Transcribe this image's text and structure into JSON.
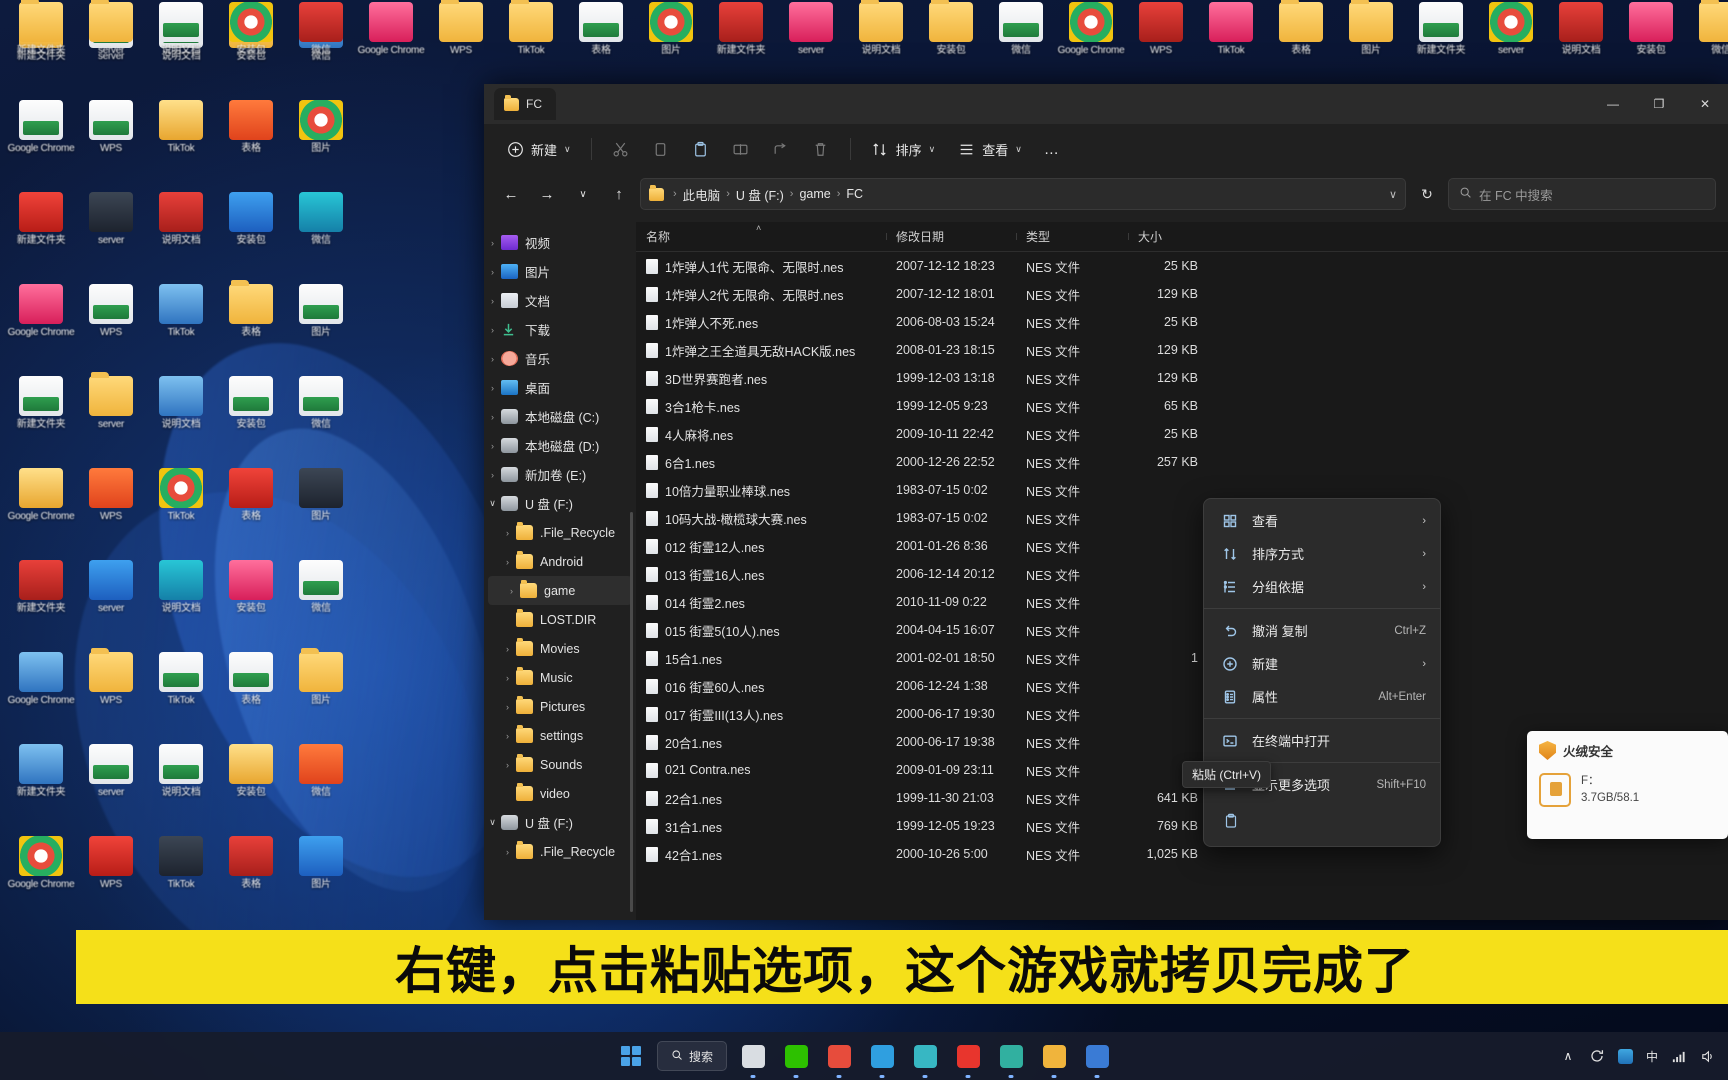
{
  "window": {
    "tab_title": "FC",
    "minimize": "—",
    "maximize": "❐",
    "close": "✕"
  },
  "toolbar": {
    "new_label": "新建",
    "new_caret": "∨",
    "cut_label": "剪切",
    "copy_label": "复制",
    "paste_label": "粘贴",
    "rename_label": "重命名",
    "share_label": "共享",
    "delete_label": "删除",
    "sort_label": "排序",
    "sort_caret": "∨",
    "view_label": "查看",
    "view_caret": "∨",
    "more_label": "…"
  },
  "address": {
    "back": "←",
    "forward": "→",
    "recent": "∨",
    "up": "↑",
    "crumbs": [
      "此电脑",
      "U 盘 (F:)",
      "game",
      "FC"
    ],
    "separator": "›",
    "dropdown": "∨",
    "refresh": "↻",
    "search_placeholder": "在 FC 中搜索"
  },
  "navpane": {
    "items": [
      {
        "label": "视频",
        "icon": "video-icon",
        "indent": 0,
        "chevron": "closed"
      },
      {
        "label": "图片",
        "icon": "pictures-icon",
        "indent": 0,
        "chevron": "closed"
      },
      {
        "label": "文档",
        "icon": "documents-icon",
        "indent": 0,
        "chevron": "closed"
      },
      {
        "label": "下载",
        "icon": "downloads-icon",
        "indent": 0,
        "chevron": "closed"
      },
      {
        "label": "音乐",
        "icon": "music-icon",
        "indent": 0,
        "chevron": "closed"
      },
      {
        "label": "桌面",
        "icon": "desktop-icon",
        "indent": 0,
        "chevron": "closed"
      },
      {
        "label": "本地磁盘 (C:)",
        "icon": "disk-icon",
        "indent": 0,
        "chevron": "closed"
      },
      {
        "label": "本地磁盘 (D:)",
        "icon": "disk-icon",
        "indent": 0,
        "chevron": "closed"
      },
      {
        "label": "新加卷 (E:)",
        "icon": "disk-icon",
        "indent": 0,
        "chevron": "closed"
      },
      {
        "label": "U 盘 (F:)",
        "icon": "disk-icon",
        "indent": 0,
        "chevron": "open"
      },
      {
        "label": ".File_Recycle",
        "icon": "folder-icon",
        "indent": 1,
        "chevron": "closed"
      },
      {
        "label": "Android",
        "icon": "folder-icon",
        "indent": 1,
        "chevron": "closed"
      },
      {
        "label": "game",
        "icon": "folder-icon",
        "indent": 1,
        "chevron": "closed",
        "selected": true
      },
      {
        "label": "LOST.DIR",
        "icon": "folder-icon",
        "indent": 1,
        "chevron": "none"
      },
      {
        "label": "Movies",
        "icon": "folder-icon",
        "indent": 1,
        "chevron": "closed"
      },
      {
        "label": "Music",
        "icon": "folder-icon",
        "indent": 1,
        "chevron": "closed"
      },
      {
        "label": "Pictures",
        "icon": "folder-icon",
        "indent": 1,
        "chevron": "closed"
      },
      {
        "label": "settings",
        "icon": "folder-icon",
        "indent": 1,
        "chevron": "closed"
      },
      {
        "label": "Sounds",
        "icon": "folder-icon",
        "indent": 1,
        "chevron": "closed"
      },
      {
        "label": "video",
        "icon": "folder-icon",
        "indent": 1,
        "chevron": "none"
      },
      {
        "label": "U 盘 (F:)",
        "icon": "disk-icon",
        "indent": 0,
        "chevron": "open"
      },
      {
        "label": ".File_Recycle",
        "icon": "folder-icon",
        "indent": 1,
        "chevron": "closed"
      }
    ]
  },
  "filelist": {
    "columns": [
      "名称",
      "修改日期",
      "类型",
      "大小"
    ],
    "sort_indicator": "˄",
    "rows": [
      {
        "name": "1炸弹人1代 无限命、无限时.nes",
        "date": "2007-12-12 18:23",
        "type": "NES 文件",
        "size": "25 KB"
      },
      {
        "name": "1炸弹人2代 无限命、无限时.nes",
        "date": "2007-12-12 18:01",
        "type": "NES 文件",
        "size": "129 KB"
      },
      {
        "name": "1炸弹人不死.nes",
        "date": "2006-08-03 15:24",
        "type": "NES 文件",
        "size": "25 KB"
      },
      {
        "name": "1炸弹之王全道具无敌HACK版.nes",
        "date": "2008-01-23 18:15",
        "type": "NES 文件",
        "size": "129 KB"
      },
      {
        "name": "3D世界赛跑者.nes",
        "date": "1999-12-03 13:18",
        "type": "NES 文件",
        "size": "129 KB"
      },
      {
        "name": "3合1枪卡.nes",
        "date": "1999-12-05 9:23",
        "type": "NES 文件",
        "size": "65 KB"
      },
      {
        "name": "4人麻将.nes",
        "date": "2009-10-11 22:42",
        "type": "NES 文件",
        "size": "25 KB"
      },
      {
        "name": "6合1.nes",
        "date": "2000-12-26 22:52",
        "type": "NES 文件",
        "size": "257 KB"
      },
      {
        "name": "10倍力量职业棒球.nes",
        "date": "1983-07-15 0:02",
        "type": "NES 文件",
        "size": ""
      },
      {
        "name": "10码大战-橄榄球大赛.nes",
        "date": "1983-07-15 0:02",
        "type": "NES 文件",
        "size": ""
      },
      {
        "name": "012 街霊12人.nes",
        "date": "2001-01-26 8:36",
        "type": "NES 文件",
        "size": ""
      },
      {
        "name": "013 街霊16人.nes",
        "date": "2006-12-14 20:12",
        "type": "NES 文件",
        "size": ""
      },
      {
        "name": "014 街霊2.nes",
        "date": "2010-11-09 0:22",
        "type": "NES 文件",
        "size": ""
      },
      {
        "name": "015 街霊5(10人).nes",
        "date": "2004-04-15 16:07",
        "type": "NES 文件",
        "size": ""
      },
      {
        "name": "15合1.nes",
        "date": "2001-02-01 18:50",
        "type": "NES 文件",
        "size": "1"
      },
      {
        "name": "016 街霊60人.nes",
        "date": "2006-12-24 1:38",
        "type": "NES 文件",
        "size": ""
      },
      {
        "name": "017 街霊III(13人).nes",
        "date": "2000-06-17 19:30",
        "type": "NES 文件",
        "size": ""
      },
      {
        "name": "20合1.nes",
        "date": "2000-06-17 19:38",
        "type": "NES 文件",
        "size": ""
      },
      {
        "name": "021 Contra.nes",
        "date": "2009-01-09 23:11",
        "type": "NES 文件",
        "size": ""
      },
      {
        "name": "22合1.nes",
        "date": "1999-11-30 21:03",
        "type": "NES 文件",
        "size": "641 KB"
      },
      {
        "name": "31合1.nes",
        "date": "1999-12-05 19:23",
        "type": "NES 文件",
        "size": "769 KB"
      },
      {
        "name": "42合1.nes",
        "date": "2000-10-26 5:00",
        "type": "NES 文件",
        "size": "1,025 KB"
      }
    ]
  },
  "contextmenu": {
    "items": [
      {
        "label": "查看",
        "icon": "grid-view-icon",
        "accel": "",
        "arrow": "›"
      },
      {
        "label": "排序方式",
        "icon": "sort-icon",
        "accel": "",
        "arrow": "›"
      },
      {
        "label": "分组依据",
        "icon": "group-icon",
        "accel": "",
        "arrow": "›"
      },
      {
        "divider": true
      },
      {
        "label": "撤消 复制",
        "icon": "undo-icon",
        "accel": "Ctrl+Z",
        "arrow": ""
      },
      {
        "label": "新建",
        "icon": "new-icon",
        "accel": "",
        "arrow": "›"
      },
      {
        "label": "属性",
        "icon": "properties-icon",
        "accel": "Alt+Enter",
        "arrow": ""
      },
      {
        "divider": true
      },
      {
        "label": "在终端中打开",
        "icon": "terminal-icon",
        "accel": "",
        "arrow": ""
      },
      {
        "divider": true
      },
      {
        "label": "显示更多选项",
        "icon": "more-options-icon",
        "accel": "Shift+F10",
        "arrow": ""
      }
    ],
    "paste_tooltip": "粘贴 (Ctrl+V)"
  },
  "toast": {
    "title": "火绒安全",
    "drive": "F：",
    "capacity": "3.7GB/58.1"
  },
  "subtitle": {
    "text": "右键，点击粘贴选项，这个游戏就拷贝完成了"
  },
  "taskbar": {
    "search_label": "搜索",
    "apps": [
      {
        "name": "taskview",
        "color": "#d9dde2"
      },
      {
        "name": "wechat",
        "color": "#2dc100"
      },
      {
        "name": "chrome",
        "color": "#e74c3c"
      },
      {
        "name": "telegram",
        "color": "#2f9fe0"
      },
      {
        "name": "explorer-u",
        "color": "#37b7c3"
      },
      {
        "name": "wps",
        "color": "#e8352d"
      },
      {
        "name": "notes",
        "color": "#31b0a0"
      },
      {
        "name": "file-explorer",
        "color": "#f0b43c"
      },
      {
        "name": "store",
        "color": "#3a7bd5"
      }
    ],
    "tray": {
      "chevron": "∧",
      "ime": "中",
      "items": [
        "update-icon",
        "security-icon",
        "network-icon",
        "volume-icon"
      ]
    }
  },
  "desktop": {
    "left_icons": [
      {
        "label": "新建文件夹",
        "kind": "folder"
      },
      {
        "label": "server",
        "kind": "folder"
      },
      {
        "label": "说明文档",
        "kind": "doc"
      },
      {
        "label": "安装包",
        "kind": "zip"
      },
      {
        "label": "微信",
        "kind": "app"
      },
      {
        "label": "Google Chrome",
        "kind": "chrome"
      },
      {
        "label": "WPS",
        "kind": "wps"
      },
      {
        "label": "TikTok",
        "kind": "dark"
      },
      {
        "label": "表格",
        "kind": "doc"
      },
      {
        "label": "图片",
        "kind": "img"
      }
    ]
  },
  "colors": {
    "accent": "#4aa3e8",
    "subtitle_bg": "#f5e019",
    "window_bg": "#202020",
    "content_bg": "#191919",
    "menu_bg": "#2b2b2b"
  }
}
